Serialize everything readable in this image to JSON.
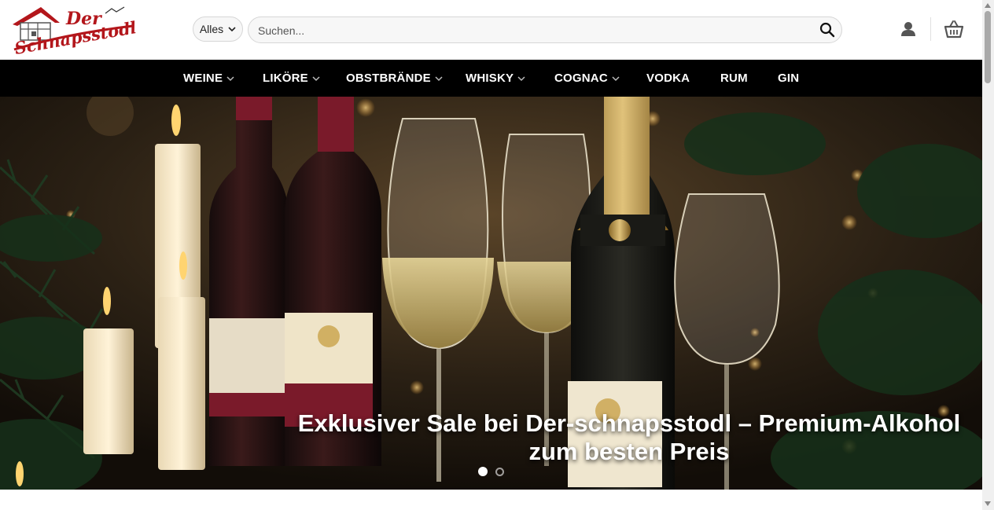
{
  "brand": {
    "logo_line1": "Der",
    "logo_line2": "Schnapsstodl"
  },
  "search": {
    "category_label": "Alles",
    "placeholder": "Suchen..."
  },
  "nav": {
    "items": [
      {
        "label": "WEINE",
        "has_dropdown": true
      },
      {
        "label": "LIKÖRE",
        "has_dropdown": true
      },
      {
        "label": "OBSTBRÄNDE",
        "has_dropdown": true
      },
      {
        "label": "WHISKY",
        "has_dropdown": true
      },
      {
        "label": "COGNAC",
        "has_dropdown": true
      },
      {
        "label": "VODKA",
        "has_dropdown": false
      },
      {
        "label": "RUM",
        "has_dropdown": false
      },
      {
        "label": "GIN",
        "has_dropdown": false
      }
    ]
  },
  "hero": {
    "caption": "Exklusiver Sale bei Der-schnapsstodl – Premium-Alkohol zum besten Preis",
    "slide_count": 2,
    "active_slide": 1
  },
  "colors": {
    "nav_bg": "#000000",
    "logo_red": "#b3161b",
    "accent_gold": "#c9a24a"
  },
  "icons": {
    "search": "search-icon",
    "user": "user-icon",
    "cart": "basket-icon"
  }
}
